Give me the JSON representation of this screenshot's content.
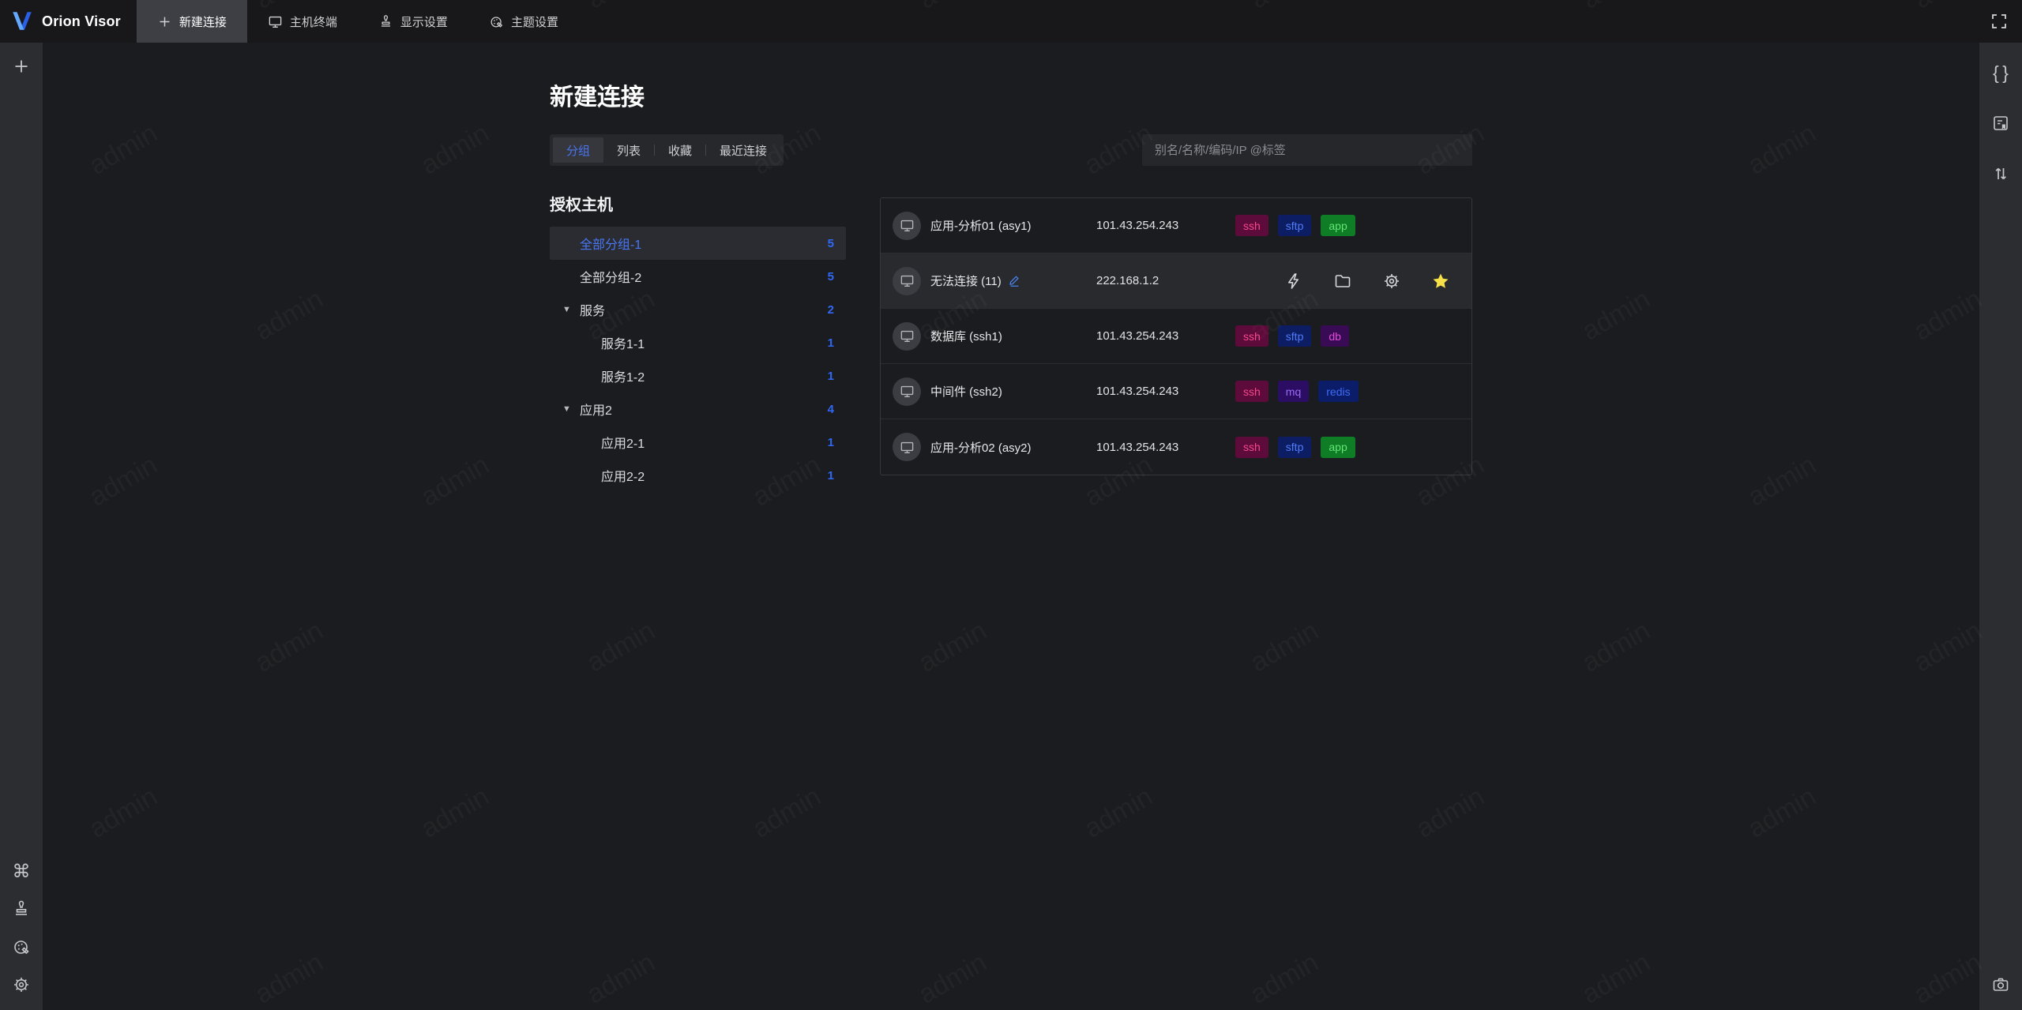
{
  "app": {
    "name": "Orion Visor",
    "watermark": "admin"
  },
  "topbar": {
    "tabs": [
      {
        "label": "新建连接",
        "icon": "plus-icon",
        "active": true
      },
      {
        "label": "主机终端",
        "icon": "terminal-icon",
        "active": false
      },
      {
        "label": "显示设置",
        "icon": "stamp-icon",
        "active": false
      },
      {
        "label": "主题设置",
        "icon": "palette-icon",
        "active": false
      }
    ]
  },
  "page": {
    "title": "新建连接",
    "view_tabs": [
      {
        "label": "分组",
        "active": true
      },
      {
        "label": "列表",
        "active": false
      },
      {
        "label": "收藏",
        "active": false
      },
      {
        "label": "最近连接",
        "active": false
      }
    ],
    "search_placeholder": "别名/名称/编码/IP @标签"
  },
  "tree": {
    "header": "授权主机",
    "items": [
      {
        "label": "全部分组-1",
        "count": "5",
        "level": 1,
        "caret": false,
        "selected": true
      },
      {
        "label": "全部分组-2",
        "count": "5",
        "level": 1,
        "caret": false,
        "selected": false
      },
      {
        "label": "服务",
        "count": "2",
        "level": 1,
        "caret": true,
        "selected": false
      },
      {
        "label": "服务1-1",
        "count": "1",
        "level": 2,
        "caret": false,
        "selected": false
      },
      {
        "label": "服务1-2",
        "count": "1",
        "level": 2,
        "caret": false,
        "selected": false
      },
      {
        "label": "应用2",
        "count": "4",
        "level": 1,
        "caret": true,
        "selected": false
      },
      {
        "label": "应用2-1",
        "count": "1",
        "level": 2,
        "caret": false,
        "selected": false
      },
      {
        "label": "应用2-2",
        "count": "1",
        "level": 2,
        "caret": false,
        "selected": false
      }
    ]
  },
  "tag_styles": {
    "ssh": {
      "bg": "#5c0b3a",
      "fg": "#f9478d"
    },
    "sftp": {
      "bg": "#0d1d63",
      "fg": "#4f7cf9"
    },
    "app": {
      "bg": "#0f7d26",
      "fg": "#63e475"
    },
    "db": {
      "bg": "#3a0b55",
      "fg": "#e04ad8"
    },
    "mq": {
      "bg": "#2b0d63",
      "fg": "#9a6bf2"
    },
    "redis": {
      "bg": "#0b1d68",
      "fg": "#3f6cf5"
    }
  },
  "hosts": {
    "rows": [
      {
        "name": "应用-分析01 (asy1)",
        "ip": "101.43.254.243",
        "tags": [
          "ssh",
          "sftp",
          "app"
        ],
        "editable": false,
        "hovered": false,
        "actions": []
      },
      {
        "name": "无法连接 (11)",
        "ip": "222.168.1.2",
        "tags": [],
        "editable": true,
        "hovered": true,
        "actions": [
          "bolt-icon",
          "folder-icon",
          "gear-icon",
          "star-icon"
        ]
      },
      {
        "name": "数据库 (ssh1)",
        "ip": "101.43.254.243",
        "tags": [
          "ssh",
          "sftp",
          "db"
        ],
        "editable": false,
        "hovered": false,
        "actions": []
      },
      {
        "name": "中间件 (ssh2)",
        "ip": "101.43.254.243",
        "tags": [
          "ssh",
          "mq",
          "redis"
        ],
        "editable": false,
        "hovered": false,
        "actions": []
      },
      {
        "name": "应用-分析02 (asy2)",
        "ip": "101.43.254.243",
        "tags": [
          "ssh",
          "sftp",
          "app"
        ],
        "editable": false,
        "hovered": false,
        "actions": []
      }
    ]
  },
  "colors": {
    "accent": "#3a66f0",
    "topbar": "#18181b",
    "rail": "#2b2d31",
    "content": "#1b1c1f",
    "star": "#f6df49",
    "edit": "#4a86f7"
  }
}
